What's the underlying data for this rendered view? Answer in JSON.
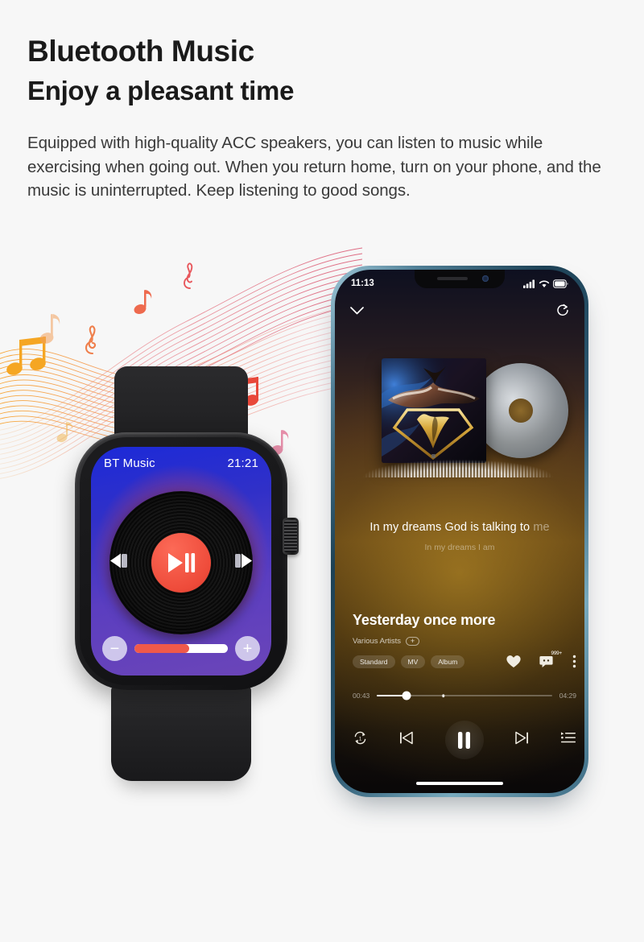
{
  "header": {
    "title": "Bluetooth Music",
    "subtitle": "Enjoy a pleasant time",
    "body": "Equipped with high-quality ACC speakers, you can listen to music while exercising when going out. When you return home, turn on your phone, and the music is uninterrupted. Keep listening to good songs."
  },
  "watch": {
    "app_label": "BT Music",
    "time": "21:21",
    "play_icon": "play-pause-icon",
    "prev_icon": "previous-track-icon",
    "next_icon": "next-track-icon",
    "volume_minus_label": "−",
    "volume_plus_label": "+",
    "volume_percent": 59,
    "screen_gradient_start": "#1c2ad8",
    "screen_gradient_end": "#6b45b8",
    "accent_color": "#f0594a"
  },
  "phone": {
    "statusbar": {
      "time": "11:13",
      "signal_icon": "cellular-signal-icon",
      "wifi_icon": "wifi-icon",
      "battery_icon": "battery-icon"
    },
    "nav": {
      "collapse_icon": "chevron-down-icon",
      "share_icon": "share-icon"
    },
    "art": {
      "cover_icon": "album-cover-art",
      "disc_icon": "vinyl-disc-icon"
    },
    "lyrics": {
      "active_line_lit": "In my dreams God is talking to",
      "active_line_dim": "me",
      "next_line": "In my dreams I am"
    },
    "song": {
      "title": "Yesterday once more",
      "artist": "Various Artists",
      "follow_label": "+",
      "tags": [
        "Standard",
        "MV",
        "Album"
      ],
      "like_icon": "heart-icon",
      "comment_icon": "comment-icon",
      "comment_count": "999+",
      "more_icon": "more-vertical-icon"
    },
    "progress": {
      "elapsed": "00:43",
      "total": "04:29",
      "percent": 17,
      "marker_percent": 38
    },
    "transport": {
      "repeat_icon": "repeat-one-icon",
      "prev_icon": "skip-previous-icon",
      "pause_icon": "pause-icon",
      "next_icon": "skip-next-icon",
      "queue_icon": "playlist-queue-icon"
    },
    "home_indicator_icon": "home-indicator"
  },
  "decoration": {
    "wave_icon": "music-wave-ribbon",
    "note_icons": [
      "music-note-icon",
      "beamed-notes-icon",
      "treble-clef-icon"
    ],
    "wave_warm_color": "#F7A833",
    "wave_pink_color": "#E8607A",
    "note_red_color": "#E8483A"
  }
}
